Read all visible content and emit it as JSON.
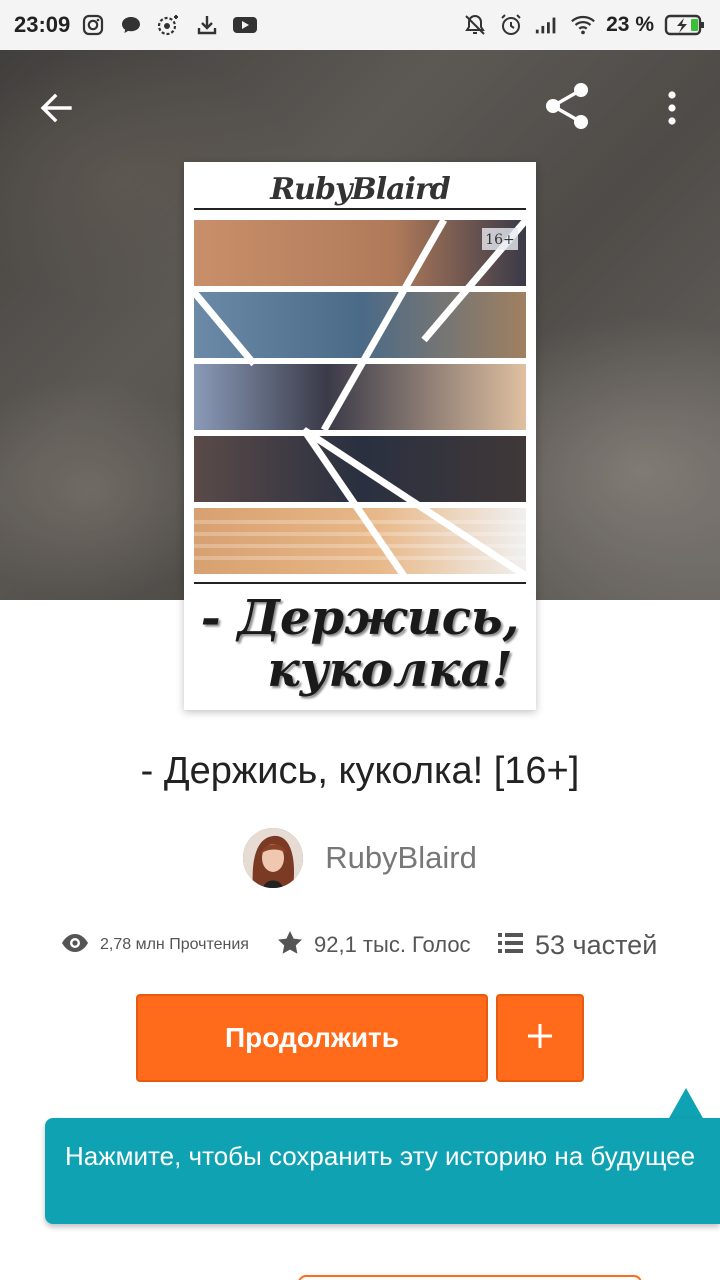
{
  "status_bar": {
    "time": "23:09",
    "battery_percent": "23 %",
    "left_icons": [
      "instagram-icon",
      "chat-bubble-icon",
      "vpn-icon",
      "download-icon",
      "youtube-icon"
    ],
    "right_icons": [
      "muted-bell-icon",
      "alarm-icon",
      "signal-icon",
      "wifi-icon",
      "battery-charging-icon"
    ]
  },
  "header": {
    "back_icon": "arrow-left-icon",
    "share_icon": "share-icon",
    "more_icon": "more-vertical-icon"
  },
  "cover": {
    "author_script": "RubyBlaird",
    "badge": "16+",
    "title_line1": "- Держись,",
    "title_line2": "куколка!"
  },
  "story": {
    "title": "- Держись, куколка! [16+]",
    "author": "RubyBlaird",
    "stats": {
      "reads": "2,78 млн Прочтения",
      "votes": "92,1 тыс. Голос",
      "parts": "53 частей"
    }
  },
  "actions": {
    "continue_label": "Продолжить",
    "add_icon": "plus-icon"
  },
  "tooltip": {
    "text": "Нажмите, чтобы сохранить эту историю на будущее"
  },
  "colors": {
    "accent": "#ff6b1a",
    "tooltip": "#0ea2b3"
  }
}
